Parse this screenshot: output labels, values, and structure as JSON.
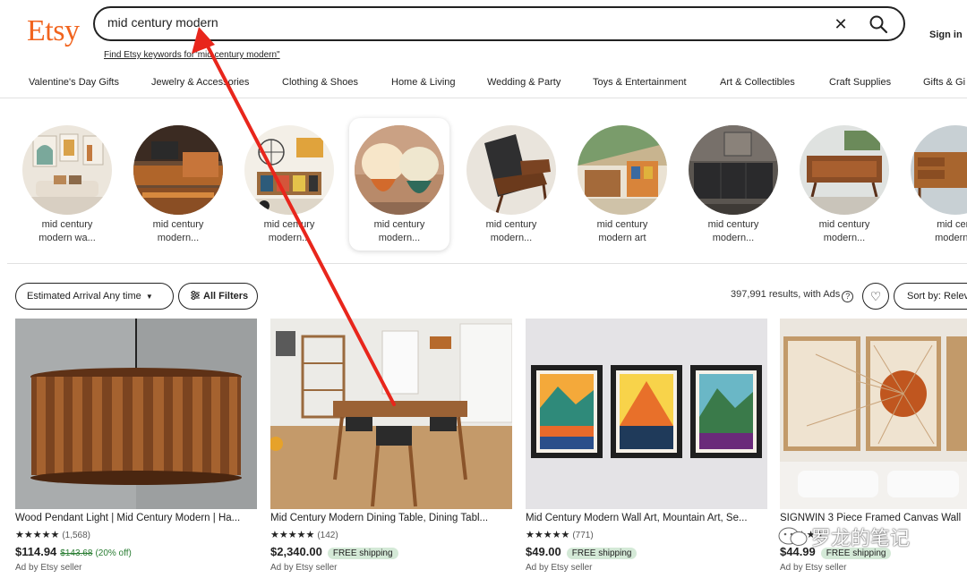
{
  "header": {
    "logo": "Etsy",
    "search_value": "mid century modern",
    "suggest_link": "Find Etsy keywords for\"mid century modern\"",
    "sign_in": "Sign in"
  },
  "categories": [
    "Valentine's Day Gifts",
    "Jewelry & Accessories",
    "Clothing & Shoes",
    "Home & Living",
    "Wedding & Party",
    "Toys & Entertainment",
    "Art & Collectibles",
    "Craft Supplies",
    "Gifts & Gi"
  ],
  "related": [
    {
      "line1": "mid century",
      "line2": "modern wa..."
    },
    {
      "line1": "mid century",
      "line2": "modern..."
    },
    {
      "line1": "mid century",
      "line2": "modern..."
    },
    {
      "line1": "mid century",
      "line2": "modern..."
    },
    {
      "line1": "mid century",
      "line2": "modern..."
    },
    {
      "line1": "mid century",
      "line2": "modern art"
    },
    {
      "line1": "mid century",
      "line2": "modern..."
    },
    {
      "line1": "mid century",
      "line2": "modern..."
    },
    {
      "line1": "mid cent",
      "line2": "modern c"
    }
  ],
  "filters": {
    "arrival_label": "Estimated Arrival",
    "arrival_value": "Any time",
    "all_filters": "All Filters",
    "results": "397,991 results, with Ads",
    "sort": "Sort by: Relev"
  },
  "products": [
    {
      "title": "Wood Pendant Light | Mid Century Modern | Ha...",
      "stars": "★★★★★",
      "count": "(1,568)",
      "price": "$114.94",
      "original": "$143.68",
      "discount": "(20% off)",
      "shipping": "",
      "ad": "Ad by Etsy seller"
    },
    {
      "title": "Mid Century Modern Dining Table, Dining Tabl...",
      "stars": "★★★★★",
      "count": "(142)",
      "price": "$2,340.00",
      "original": "",
      "discount": "",
      "shipping": "FREE shipping",
      "ad": "Ad by Etsy seller"
    },
    {
      "title": "Mid Century Modern Wall Art, Mountain Art, Se...",
      "stars": "★★★★★",
      "count": "(771)",
      "price": "$49.00",
      "original": "",
      "discount": "",
      "shipping": "FREE shipping",
      "ad": "Ad by Etsy seller"
    },
    {
      "title": "SIGNWIN 3 Piece Framed Canvas Wall",
      "stars": "★★★★★",
      "count": "",
      "price": "$44.99",
      "original": "",
      "discount": "",
      "shipping": "FREE shipping",
      "ad": "Ad by Etsy seller"
    }
  ],
  "watermark": "罗龙的笔记",
  "colors": {
    "brand": "#f1641e",
    "annotation_arrow": "#e8261c",
    "ship_badge": "#d4e9d7"
  }
}
